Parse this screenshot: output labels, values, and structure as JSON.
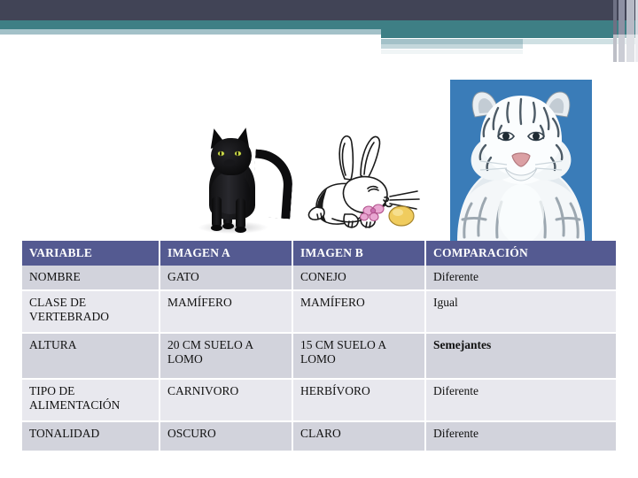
{
  "banner": {
    "navy_color": "#414456",
    "teal_color": "#3E7F85",
    "light_blue_color": "#A3C1C8",
    "pale_color": "#CFE0E3"
  },
  "images": {
    "image_a": {
      "name": "cat-illustration",
      "subject": "Gato negro",
      "alt": "Gato negro de pie con la cola levantada"
    },
    "image_b": {
      "name": "rabbit-illustration",
      "subject": "Conejo",
      "alt": "Conejo blanco dibujado a linea con flores rosas y un huevo dorado"
    },
    "image_c": {
      "name": "tiger-illustration",
      "subject": "Tigre blanco",
      "alt": "Tigre blanco sobre fondo azul",
      "background_color": "#3A7CB8"
    }
  },
  "table": {
    "header_color": "#545A91",
    "row_dark_color": "#D2D3DC",
    "row_light_color": "#E8E8EE",
    "highlight_color": "#C00000",
    "headers": [
      "VARIABLE",
      "IMAGEN A",
      "IMAGEN B",
      "COMPARACIÓN"
    ],
    "rows": [
      {
        "variable": "NOMBRE",
        "imagen_a": "GATO",
        "imagen_b": "CONEJO",
        "comparacion": "Diferente"
      },
      {
        "variable": "CLASE DE VERTEBRADO",
        "imagen_a": "MAMÍFERO",
        "imagen_b": "MAMÍFERO",
        "comparacion": "Igual"
      },
      {
        "variable": "ALTURA",
        "imagen_a": "20 CM SUELO A LOMO",
        "imagen_b": "15 CM SUELO A LOMO",
        "comparacion": "Semejantes"
      },
      {
        "variable": "TIPO DE ALIMENTACIÓN",
        "imagen_a": "CARNIVORO",
        "imagen_b": "HERBÍVORO",
        "comparacion": "Diferente"
      },
      {
        "variable": "TONALIDAD",
        "imagen_a": "OSCURO",
        "imagen_b": "CLARO",
        "comparacion": "Diferente"
      }
    ]
  }
}
